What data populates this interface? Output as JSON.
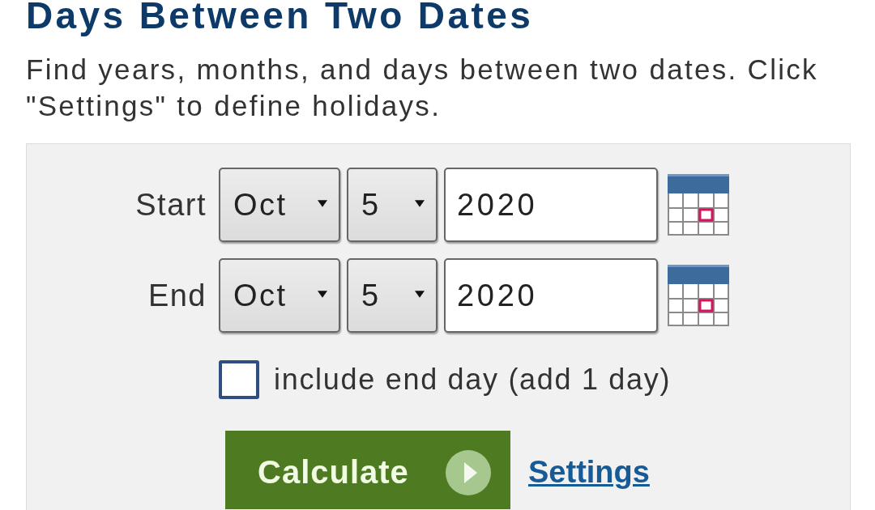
{
  "header": {
    "title": "Days Between Two Dates",
    "description": "Find years, months, and days between two dates. Click \"Settings\" to define holidays."
  },
  "form": {
    "date_rows": [
      {
        "label": "Start",
        "month": "Oct",
        "day": "5",
        "year": "2020"
      },
      {
        "label": "End",
        "month": "Oct",
        "day": "5",
        "year": "2020"
      }
    ],
    "include_end_day": {
      "label": "include end day (add 1 day)",
      "checked": false
    },
    "calculate_button": {
      "label": "Calculate"
    },
    "settings_link": {
      "label": "Settings"
    }
  }
}
